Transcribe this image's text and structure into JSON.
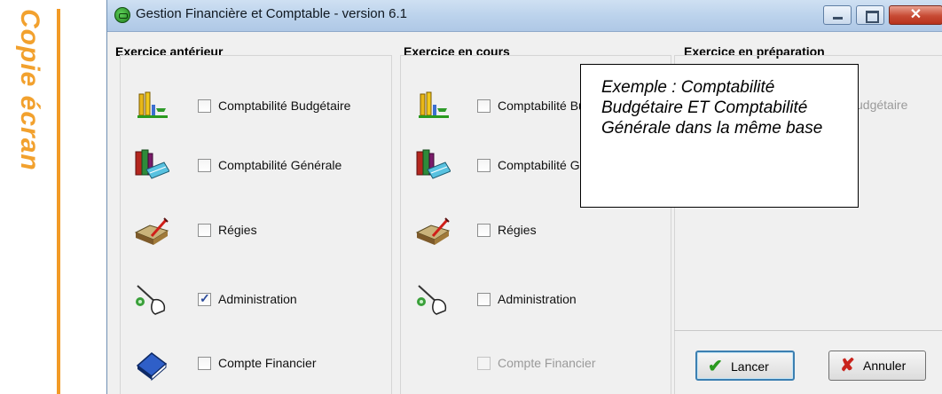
{
  "side_label": "Copie écran",
  "window": {
    "title": "Gestion Financière et Comptable - version 6.1",
    "close_glyph": "✕"
  },
  "columns": [
    {
      "header": "Exercice antérieur",
      "options": [
        {
          "label": "Comptabilité Budgétaire",
          "checked": false,
          "icon": "budget-icon"
        },
        {
          "label": "Comptabilité Générale",
          "checked": false,
          "icon": "books-icon"
        },
        {
          "label": "Régies",
          "checked": false,
          "icon": "ledger-pen-icon"
        },
        {
          "label": "Administration",
          "checked": true,
          "icon": "admin-hand-icon"
        },
        {
          "label": "Compte Financier",
          "checked": false,
          "icon": "blue-book-icon"
        }
      ]
    },
    {
      "header": "Exercice en cours",
      "options": [
        {
          "label": "Comptabilité Budgétaire",
          "checked": false,
          "icon": "budget-icon"
        },
        {
          "label": "Comptabilité Générale",
          "checked": false,
          "icon": "books-icon"
        },
        {
          "label": "Régies",
          "checked": false,
          "icon": "ledger-pen-icon"
        },
        {
          "label": "Administration",
          "checked": false,
          "icon": "admin-hand-icon"
        },
        {
          "label": "Compte Financier",
          "checked": false,
          "disabled": true
        }
      ]
    },
    {
      "header": "Exercice en préparation",
      "peek_label": "udgétaire"
    }
  ],
  "note": "Exemple : Comptabilité Budgétaire ET Comptabilité Générale dans la même base",
  "buttons": {
    "lancer": {
      "label": "Lancer",
      "icon_glyph": "✔"
    },
    "annuler": {
      "label": "Annuler",
      "icon_glyph": "✘"
    }
  }
}
